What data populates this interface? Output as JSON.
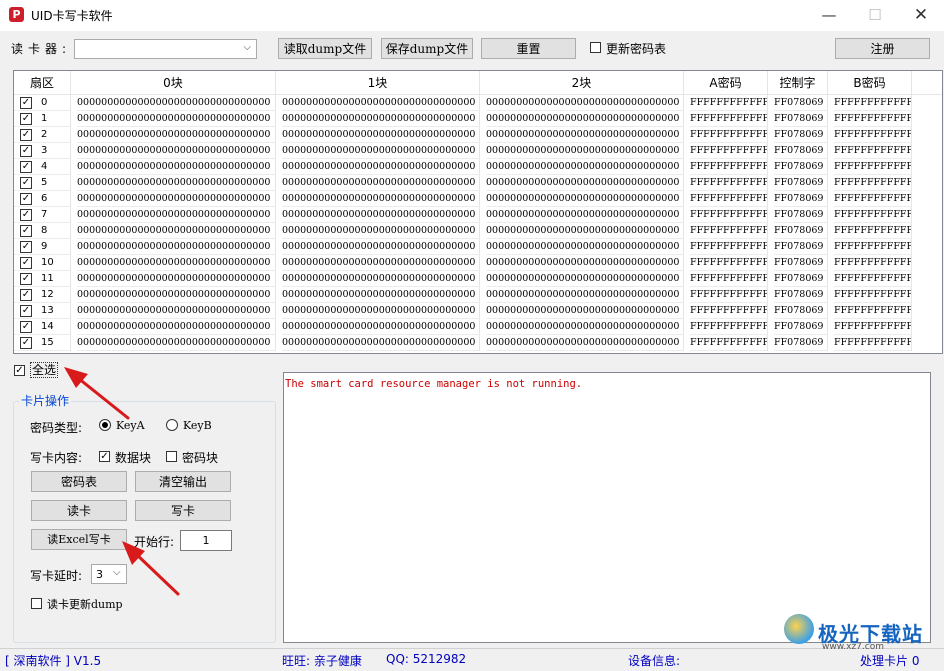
{
  "window": {
    "title": "UID卡写卡软件",
    "app_icon": "pinterest-p-icon",
    "min_glyph": "—",
    "max_glyph": "☐",
    "close_glyph": "✕"
  },
  "toolbar": {
    "reader_label": "读卡器:",
    "reader_value": "",
    "read_dump": "读取dump文件",
    "save_dump": "保存dump文件",
    "reset": "重置",
    "update_keys_label": "更新密码表",
    "update_keys_checked": false,
    "register": "注册"
  },
  "grid": {
    "headers": [
      "扇区",
      "0块",
      "1块",
      "2块",
      "A密码",
      "控制字",
      "B密码"
    ],
    "block_value": "00000000000000000000000000000000",
    "key_a": "FFFFFFFFFFFF",
    "access": "FF078069",
    "key_b": "FFFFFFFFFFFF",
    "sectors": [
      "0",
      "1",
      "2",
      "3",
      "4",
      "5",
      "6",
      "7",
      "8",
      "9",
      "10",
      "11",
      "12",
      "13",
      "14",
      "15"
    ]
  },
  "select_all": {
    "label": "全选",
    "checked": true
  },
  "card_ops": {
    "title": "卡片操作",
    "key_type_label": "密码类型:",
    "key_a": "KeyA",
    "key_b": "KeyB",
    "key_selected": "KeyA",
    "write_content_label": "写卡内容:",
    "data_block_label": "数据块",
    "data_block_checked": true,
    "key_block_label": "密码块",
    "key_block_checked": false,
    "btn_keys": "密码表",
    "btn_clear": "清空输出",
    "btn_read": "读卡",
    "btn_write": "写卡",
    "btn_excel": "读Excel写卡",
    "start_row_label": "开始行:",
    "start_row_value": "1",
    "delay_label": "写卡延时:",
    "delay_value": "3",
    "update_dump_label": "读卡更新dump",
    "update_dump_checked": false
  },
  "output": {
    "text": "The smart card resource manager is not running."
  },
  "statusbar": {
    "vendor": "[ 深南软件 ]  V1.5",
    "wangwang": "旺旺: 亲子健康",
    "qq": "QQ: 5212982",
    "device": "设备信息:",
    "processed": "处理卡片 0"
  },
  "watermark": {
    "brand": "极光下载站",
    "url": "www.xz7.com"
  },
  "colors": {
    "accent_blue": "#0046d5",
    "status_blue": "#0000c0",
    "error_red": "#cc0000",
    "arrow_red": "#d91a1a"
  }
}
